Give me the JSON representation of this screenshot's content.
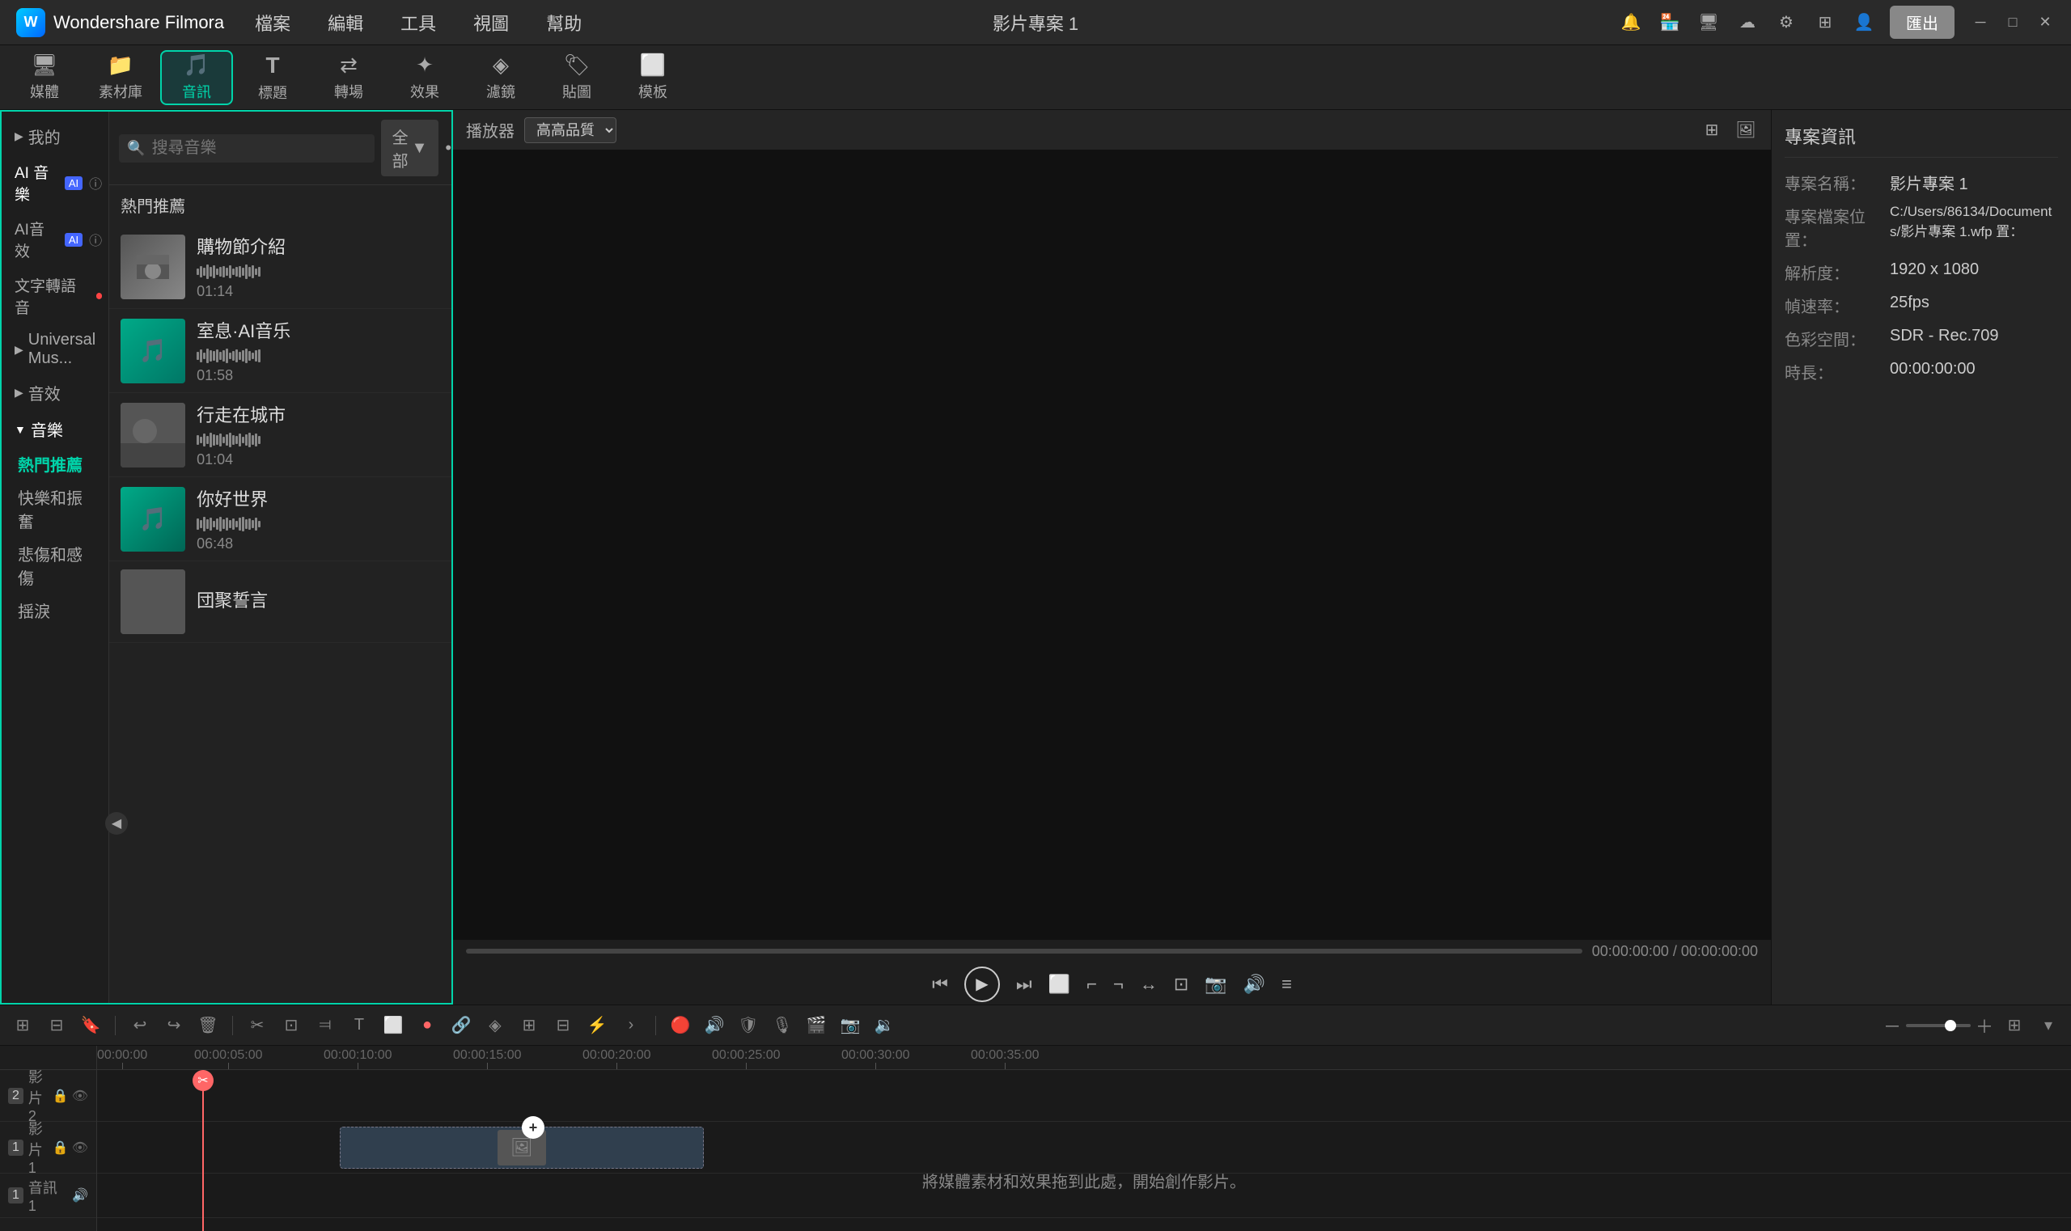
{
  "app": {
    "name": "Wondershare Filmora",
    "logo_letter": "W",
    "project_title": "影片專案 1"
  },
  "menu": {
    "items": [
      "檔案",
      "編輯",
      "工具",
      "視圖",
      "幫助"
    ]
  },
  "titlebar": {
    "export_label": "匯出"
  },
  "toolbar": {
    "items": [
      {
        "id": "media",
        "icon": "⬛",
        "label": "媒體"
      },
      {
        "id": "material",
        "icon": "📁",
        "label": "素材庫"
      },
      {
        "id": "audio",
        "icon": "🎵",
        "label": "音訊",
        "active": true
      },
      {
        "id": "title",
        "icon": "T",
        "label": "標題"
      },
      {
        "id": "transition",
        "icon": "↔",
        "label": "轉場"
      },
      {
        "id": "effect",
        "icon": "✨",
        "label": "效果"
      },
      {
        "id": "filter",
        "icon": "🎨",
        "label": "濾鏡"
      },
      {
        "id": "sticker",
        "icon": "🏷",
        "label": "貼圖"
      },
      {
        "id": "template",
        "icon": "⬜",
        "label": "模板"
      }
    ]
  },
  "sidebar": {
    "items": [
      {
        "id": "mine",
        "label": "我的",
        "expandable": true,
        "expanded": false
      },
      {
        "id": "ai-music",
        "label": "AI 音樂",
        "has_ai": true,
        "has_info": true
      },
      {
        "id": "ai-effect",
        "label": "AI音效",
        "has_ai": true,
        "has_info": true
      },
      {
        "id": "text-to-speech",
        "label": "文字轉語音",
        "has_new": true
      },
      {
        "id": "universal-music",
        "label": "Universal Mus...",
        "expandable": true
      },
      {
        "id": "sound-effect",
        "label": "音效",
        "expandable": true
      },
      {
        "id": "music",
        "label": "音樂",
        "expandable": true,
        "expanded": true
      },
      {
        "id": "popular",
        "label": "熱門推薦",
        "sub": true,
        "active": true
      },
      {
        "id": "happy",
        "label": "快樂和振奮",
        "sub": true
      },
      {
        "id": "sad",
        "label": "悲傷和感傷",
        "sub": true
      },
      {
        "id": "relax",
        "label": "揺淚",
        "sub": true
      },
      {
        "id": "collapse-icon",
        "label": "<"
      }
    ]
  },
  "search": {
    "placeholder": "搜尋音樂",
    "filter_label": "全部",
    "section_title": "熱門推薦"
  },
  "music_items": [
    {
      "id": 1,
      "title": "購物節介紹",
      "duration": "01:14",
      "thumb_type": "desert"
    },
    {
      "id": 2,
      "title": "室息·AI音乐",
      "duration": "01:58",
      "thumb_type": "teal",
      "has_download": true
    },
    {
      "id": 3,
      "title": "行走在城市",
      "duration": "01:04",
      "thumb_type": "rock",
      "has_download": true
    },
    {
      "id": 4,
      "title": "你好世界",
      "duration": "06:48",
      "thumb_type": "teal2",
      "has_download": true
    },
    {
      "id": 5,
      "title": "団聚誓言",
      "duration": "",
      "thumb_type": "rock"
    }
  ],
  "preview": {
    "playback_label": "播放器",
    "quality_label": "高高品質",
    "time_current": "00:00:00:00",
    "time_separator": " / ",
    "time_total": "00:00:00:00"
  },
  "info_panel": {
    "title": "專案資訊",
    "rows": [
      {
        "label": "專案名稱：",
        "value": "影片專案 1"
      },
      {
        "label": "專案檔案位置：",
        "value": "C:/Users/86134/Documents/影片專案 1.wfp 置："
      },
      {
        "label": "解析度：",
        "value": "1920 x 1080"
      },
      {
        "label": "幀速率：",
        "value": "25fps"
      },
      {
        "label": "色彩空間：",
        "value": "SDR - Rec.709"
      },
      {
        "label": "時長：",
        "value": "00:00:00:00"
      }
    ]
  },
  "timeline": {
    "ruler_marks": [
      "00:00:00",
      "00:00:05:00",
      "00:00:10:00",
      "00:00:15:00",
      "00:00:20:00",
      "00:00:25:00",
      "00:00:30:00",
      "00:00:35:00"
    ],
    "tracks": [
      {
        "id": "video2",
        "label": "影片 2",
        "num": "2"
      },
      {
        "id": "video1",
        "label": "影片 1",
        "num": "1"
      },
      {
        "id": "audio1",
        "label": "音訊 1",
        "num": "1"
      }
    ],
    "drop_hint": "將媒體素材和效果拖到此處，開始創作影片。"
  }
}
